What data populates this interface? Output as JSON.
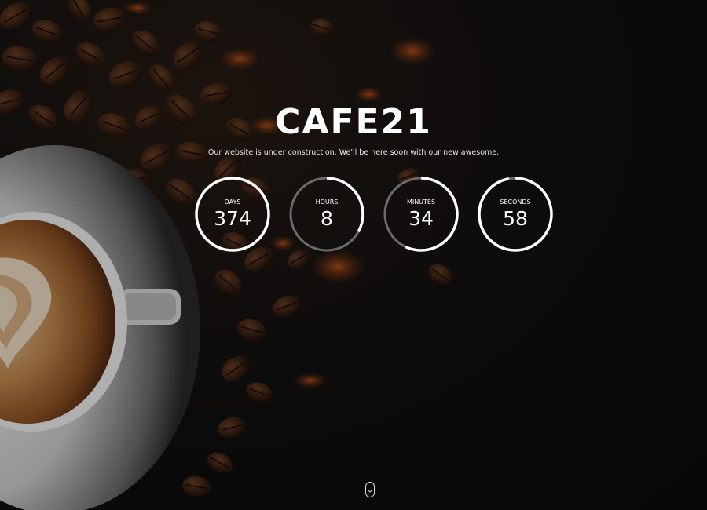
{
  "brand": {
    "title": "CAFE21"
  },
  "message": {
    "text": "Our website is under construction. We'll be here soon with our new awesome."
  },
  "countdown": {
    "ring_color": "#ffffff",
    "track_color": "#6b6b6b",
    "timers": [
      {
        "key": "days",
        "label": "DAYS",
        "value": "374",
        "progress": 1.0
      },
      {
        "key": "hours",
        "label": "HOURS",
        "value": "8",
        "progress": 0.33
      },
      {
        "key": "minutes",
        "label": "MINUTES",
        "value": "34",
        "progress": 0.57
      },
      {
        "key": "seconds",
        "label": "SECONDS",
        "value": "58",
        "progress": 0.97
      }
    ]
  },
  "scroll_indicator": {
    "icon": "chevron-down-icon"
  },
  "background": {
    "subject": "coffee cup with latte art and coffee beans",
    "colors": {
      "base": "#0e0d0d",
      "bean": "#3b2214",
      "crema": "#b57a3f",
      "cup": "#e9e9e9",
      "spice": "#b5501c"
    }
  }
}
